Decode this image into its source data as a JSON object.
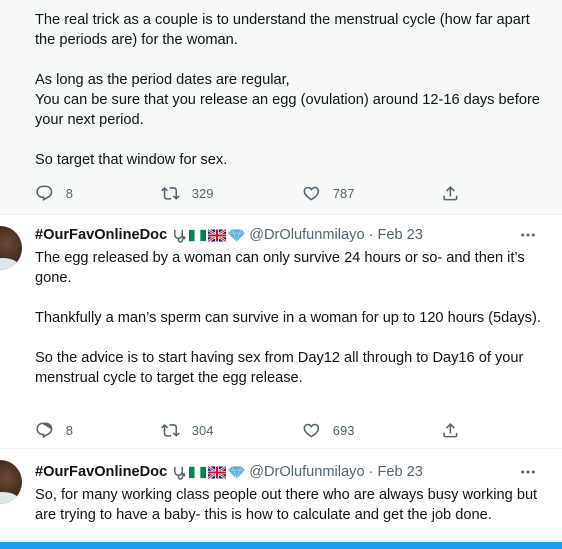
{
  "tweets": [
    {
      "text": "The real trick as a couple is to understand the menstrual cycle (how far apart the periods are) for the woman.\n\nAs long as the period dates are regular,\nYou can be sure that you release an egg (ovulation) around 12-16 days before your next period.\n\nSo target that window for sex.",
      "replies": "8",
      "retweets": "329",
      "likes": "787"
    },
    {
      "name": "#OurFavOnlineDoc",
      "handle": "@DrOlufunmilayo",
      "separator": "·",
      "date": "Feb 23",
      "text": "The egg released by a woman can only survive 24 hours or so- and then it’s gone.\n\nThankfully a man’s sperm can survive in a woman for up to 120 hours (5days).\n\nSo the advice is to start having sex from Day12 all through to Day16 of your menstrual cycle to target the egg release.",
      "replies": "8",
      "retweets": "304",
      "likes": "693"
    },
    {
      "name": "#OurFavOnlineDoc",
      "handle": "@DrOlufunmilayo",
      "separator": "·",
      "date": "Feb 23",
      "text": "So, for many working class people out there who are always busy working but are trying to have a baby- this is how to calculate and get the job done."
    }
  ],
  "name_emojis": [
    "stethoscope-emoji",
    "nigeria-flag-emoji",
    "uk-flag-emoji",
    "gem-emoji"
  ],
  "colors": {
    "text": "#0f1419",
    "muted": "#536471",
    "accent": "#1d9bf0",
    "highlight_bg": "#f7f9f9"
  }
}
